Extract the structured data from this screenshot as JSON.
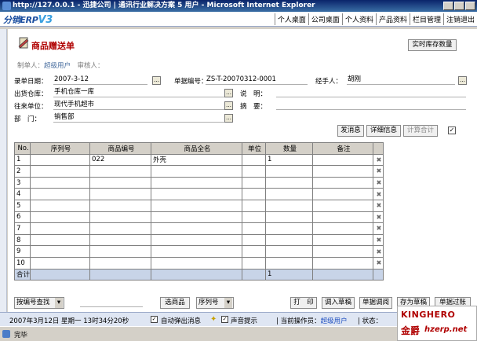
{
  "window": {
    "title": "http://127.0.0.1 - 迅捷公司  | 通讯行业解决方案 5 用户 - Microsoft Internet Explorer"
  },
  "header": {
    "logo_text": "分销ERP",
    "logo_version": "V3",
    "nav": [
      "个人桌面",
      "公司桌面",
      "个人资料",
      "产品资料",
      "栏目管理",
      "注销退出"
    ]
  },
  "form": {
    "title": "商品赠送单",
    "maker_label": "制单人：",
    "maker_value": "超级用户",
    "auditor_label": "审核人：",
    "realtime_stock_button": "实时库存数量",
    "entry_date_label": "录单日期：",
    "entry_date": "2007-3-12",
    "doc_no_label": "单据编号：",
    "doc_no": "ZS-T-20070312-0001",
    "handler_label": "经手人：",
    "handler": "胡刚",
    "warehouse_label": "出货仓库：",
    "warehouse": "手机仓库一库",
    "note_label": "说　明：",
    "note": "",
    "partner_label": "往来单位：",
    "partner": "现代手机超市",
    "summary_label": "摘　要：",
    "summary": "",
    "dept_label": "部　门：",
    "dept": "销售部"
  },
  "actions": {
    "send_message": "发消息",
    "detail_info": "详细信息",
    "calc_total": "计算合计"
  },
  "table": {
    "headers": [
      "No.",
      "序列号",
      "商品编号",
      "商品全名",
      "单位",
      "数量",
      "备注"
    ],
    "rows": [
      {
        "no": "1",
        "serial": "",
        "code": "022",
        "name": "外壳",
        "unit": "",
        "qty": "1",
        "remark": ""
      },
      {
        "no": "2",
        "serial": "",
        "code": "",
        "name": "",
        "unit": "",
        "qty": "",
        "remark": ""
      },
      {
        "no": "3",
        "serial": "",
        "code": "",
        "name": "",
        "unit": "",
        "qty": "",
        "remark": ""
      },
      {
        "no": "4",
        "serial": "",
        "code": "",
        "name": "",
        "unit": "",
        "qty": "",
        "remark": ""
      },
      {
        "no": "5",
        "serial": "",
        "code": "",
        "name": "",
        "unit": "",
        "qty": "",
        "remark": ""
      },
      {
        "no": "6",
        "serial": "",
        "code": "",
        "name": "",
        "unit": "",
        "qty": "",
        "remark": ""
      },
      {
        "no": "7",
        "serial": "",
        "code": "",
        "name": "",
        "unit": "",
        "qty": "",
        "remark": ""
      },
      {
        "no": "8",
        "serial": "",
        "code": "",
        "name": "",
        "unit": "",
        "qty": "",
        "remark": ""
      },
      {
        "no": "9",
        "serial": "",
        "code": "",
        "name": "",
        "unit": "",
        "qty": "",
        "remark": ""
      },
      {
        "no": "10",
        "serial": "",
        "code": "",
        "name": "",
        "unit": "",
        "qty": "",
        "remark": ""
      }
    ],
    "total_label": "合计",
    "total_qty": "1"
  },
  "bottom": {
    "search_select": "按编号查找",
    "select_goods": "选商品",
    "serial_select": "序列号",
    "print": "打　印",
    "load_draft": "调入草稿",
    "doc_adjust": "单据调阅",
    "save_draft": "存为草稿",
    "post": "单据过账"
  },
  "status": {
    "datetime": "2007年3月12日 星期一 13时34分20秒",
    "auto_popup": "自动弹出消息",
    "sound_tip": "声音提示",
    "operator_label": "当前操作员：",
    "operator": "超级用户",
    "state_label": "状态："
  },
  "ie": {
    "done": "完毕"
  },
  "brand": {
    "name": "KINGHERO",
    "cn": "金爵",
    "url": "hzerp.net"
  }
}
